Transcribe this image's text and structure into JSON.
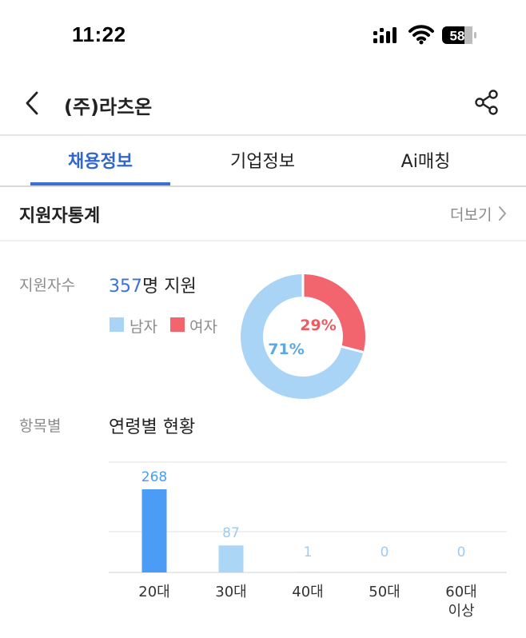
{
  "status_bar": {
    "time": "11:22",
    "battery": "58"
  },
  "header": {
    "title": "(주)라츠온"
  },
  "tabs": [
    {
      "label": "채용정보",
      "active": true
    },
    {
      "label": "기업정보",
      "active": false
    },
    {
      "label": "Ai매칭",
      "active": false
    }
  ],
  "section": {
    "title": "지원자통계",
    "more_label": "더보기"
  },
  "applicants": {
    "label": "지원자수",
    "count": "357",
    "count_suffix": "명 지원",
    "legend": [
      {
        "label": "남자",
        "color": "#a9d4f5"
      },
      {
        "label": "여자",
        "color": "#f2656e"
      }
    ],
    "male_pct_label": "71%",
    "female_pct_label": "29%"
  },
  "by_item": {
    "label": "항목별",
    "title": "연령별 현황"
  },
  "chart_data": [
    {
      "type": "pie",
      "categories": [
        "남자",
        "여자"
      ],
      "values": [
        71,
        29
      ],
      "labels": [
        "71%",
        "29%"
      ],
      "colors": [
        "#a9d4f5",
        "#f2656e"
      ],
      "donut": true
    },
    {
      "type": "bar",
      "title": "연령별 현황",
      "categories": [
        "20대",
        "30대",
        "40대",
        "50대",
        "60대\n이상"
      ],
      "values": [
        268,
        87,
        1,
        0,
        0
      ],
      "ylim": [
        0,
        300
      ],
      "grid": true,
      "colors": [
        "#4b9cf5",
        "#acd6f6",
        "#acd6f6",
        "#acd6f6",
        "#acd6f6"
      ],
      "label_colors": [
        "#4b9cf5",
        "#9ecbf0",
        "#9ecbf0",
        "#9ecbf0",
        "#9ecbf0"
      ]
    }
  ]
}
